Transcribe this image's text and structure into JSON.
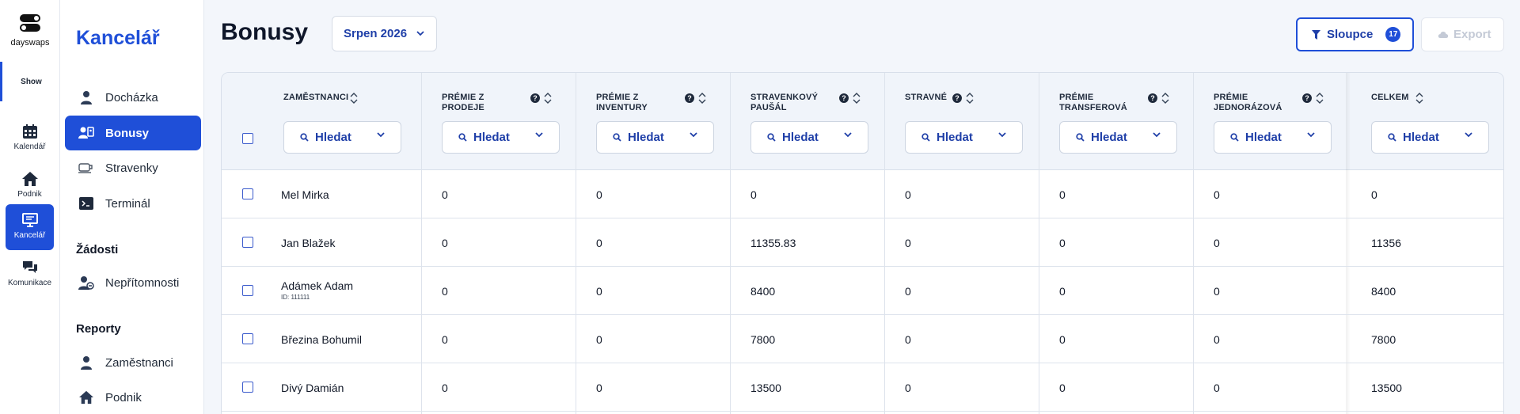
{
  "rail": {
    "logo_text": "dayswaps",
    "show_label": "Show",
    "items": [
      {
        "label": "Kalendář",
        "icon": "calendar-icon"
      },
      {
        "label": "Podnik",
        "icon": "home-icon"
      },
      {
        "label": "Kancelář",
        "icon": "office-icon"
      },
      {
        "label": "Komunikace",
        "icon": "chat-icon"
      }
    ]
  },
  "sidebar": {
    "title": "Kancelář",
    "items": [
      {
        "label": "Docházka",
        "icon": "person-icon"
      },
      {
        "label": "Bonusy",
        "icon": "id-card-icon"
      },
      {
        "label": "Stravenky",
        "icon": "coffee-icon"
      },
      {
        "label": "Terminál",
        "icon": "terminal-icon"
      }
    ],
    "requests_heading": "Žádosti",
    "requests_items": [
      {
        "label": "Nepřítomnosti",
        "icon": "person-absence-icon"
      }
    ],
    "reports_heading": "Reporty",
    "reports_items": [
      {
        "label": "Zaměstnanci",
        "icon": "person-icon"
      },
      {
        "label": "Podnik",
        "icon": "home-icon"
      }
    ]
  },
  "header": {
    "title": "Bonusy",
    "month": "Srpen 2026",
    "columns_label": "Sloupce",
    "columns_count": "17",
    "export_label": "Export"
  },
  "table": {
    "search_label": "Hledat",
    "columns": [
      {
        "label": "ZAMĚSTNANCI",
        "help": false
      },
      {
        "label": "PRÉMIE Z PRODEJE",
        "help": true
      },
      {
        "label": "PRÉMIE Z INVENTURY",
        "help": true
      },
      {
        "label": "STRAVENKOVÝ PAUŠÁL",
        "help": true
      },
      {
        "label": "STRAVNÉ",
        "help": true
      },
      {
        "label": "PRÉMIE TRANSFEROVÁ",
        "help": true
      },
      {
        "label": "PRÉMIE JEDNORÁZOVÁ",
        "help": true
      },
      {
        "label": "CELKEM",
        "help": false
      }
    ],
    "rows": [
      {
        "name": "Mel Mirka",
        "sub": "",
        "values": [
          "0",
          "0",
          "0",
          "0",
          "0",
          "0",
          "0"
        ]
      },
      {
        "name": "Jan Blažek",
        "sub": "",
        "values": [
          "0",
          "0",
          "11355.83",
          "0",
          "0",
          "0",
          "11356"
        ]
      },
      {
        "name": "Adámek Adam",
        "sub": "ID: 111111",
        "values": [
          "0",
          "0",
          "8400",
          "0",
          "0",
          "0",
          "8400"
        ]
      },
      {
        "name": "Březina Bohumil",
        "sub": "",
        "values": [
          "0",
          "0",
          "7800",
          "0",
          "0",
          "0",
          "7800"
        ]
      },
      {
        "name": "Divý Damián",
        "sub": "",
        "values": [
          "0",
          "0",
          "13500",
          "0",
          "0",
          "0",
          "13500"
        ]
      }
    ]
  },
  "colors": {
    "accent": "#1f4fd8",
    "accent_text": "#1f3fa8",
    "background": "#f3f6fb"
  }
}
